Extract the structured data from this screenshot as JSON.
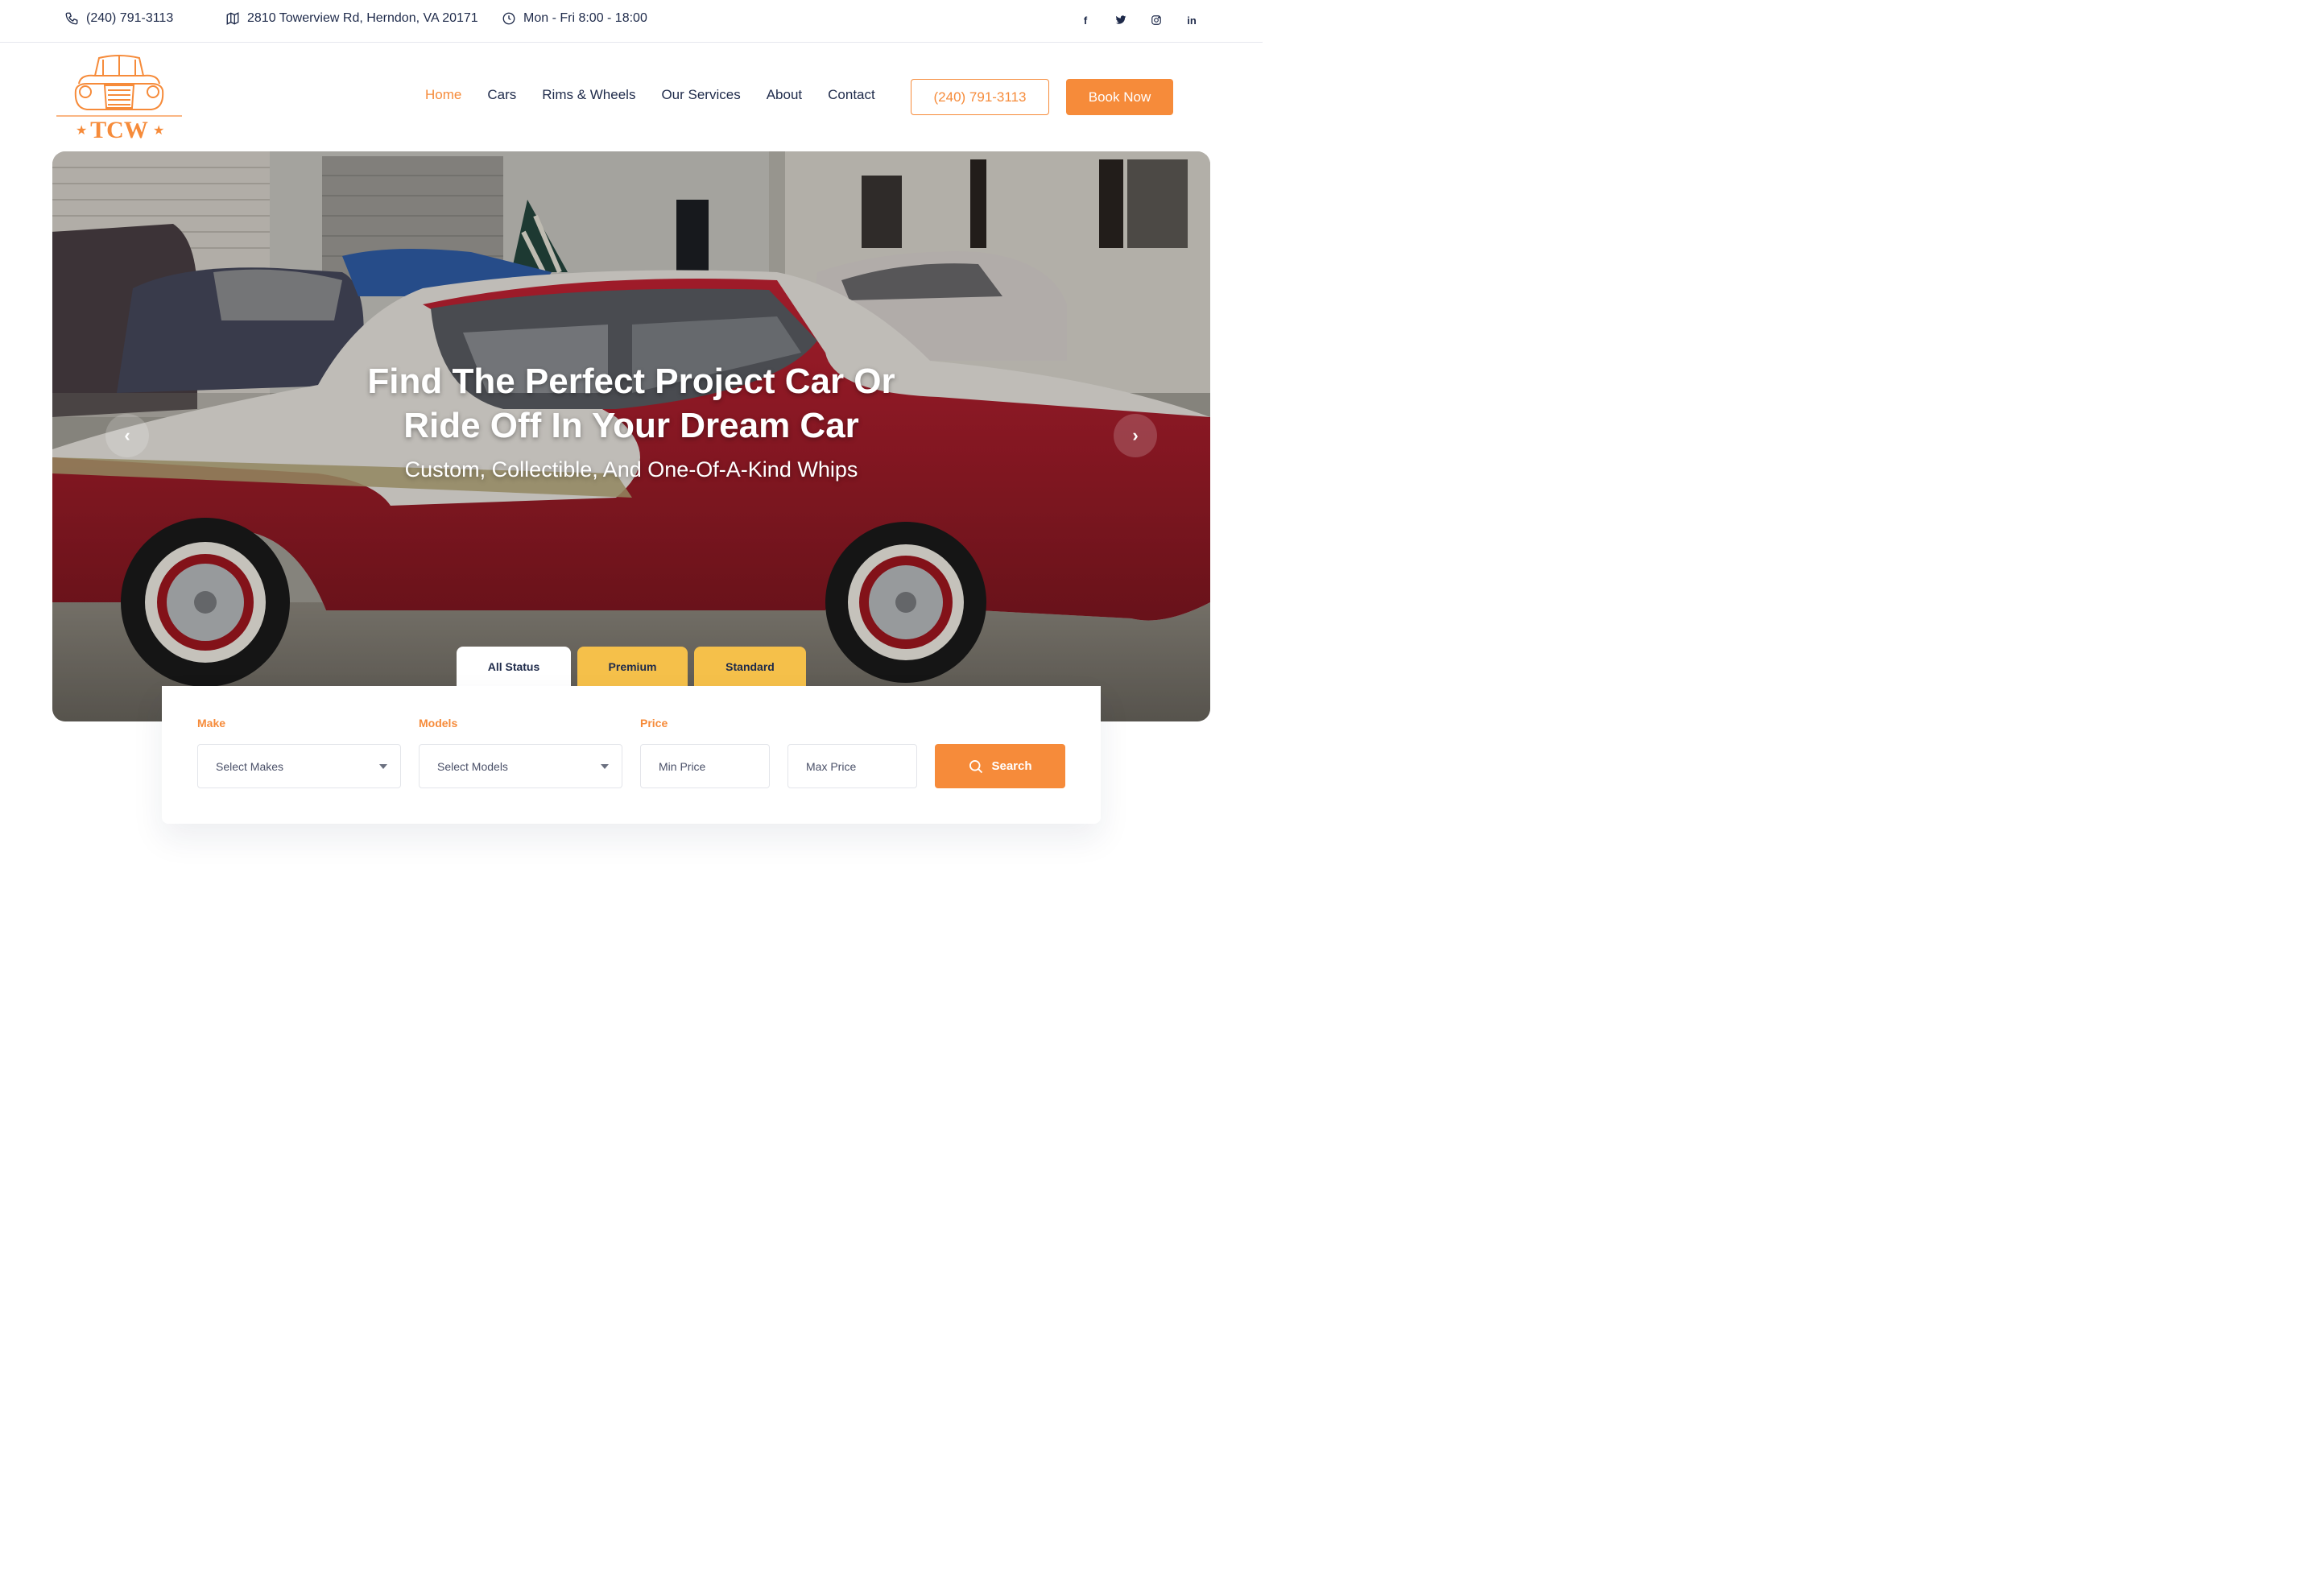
{
  "topbar": {
    "phone": "(240) 791-3113",
    "address": "2810 Towerview Rd, Herndon, VA 20171",
    "hours": "Mon - Fri 8:00 - 18:00",
    "socials": [
      {
        "icon": "facebook-icon",
        "glyph": "f"
      },
      {
        "icon": "twitter-icon",
        "glyph": "t"
      },
      {
        "icon": "instagram-icon",
        "glyph": "◎"
      },
      {
        "icon": "linkedin-icon",
        "glyph": "in"
      }
    ]
  },
  "header": {
    "logo_text": "TCW",
    "nav": [
      {
        "label": "Home",
        "active": true
      },
      {
        "label": "Cars"
      },
      {
        "label": "Rims & Wheels"
      },
      {
        "label": "Our Services"
      },
      {
        "label": "About"
      },
      {
        "label": "Contact"
      }
    ],
    "phone_button": "(240) 791-3113",
    "book_button": "Book Now"
  },
  "hero": {
    "title_line1": "Find The Perfect Project Car Or",
    "title_line2": "Ride Off In Your Dream Car",
    "subtitle": "Custom, Collectible, And One-Of-A-Kind Whips",
    "prev_glyph": "‹",
    "next_glyph": "›"
  },
  "tabs": [
    "All Status",
    "Premium",
    "Standard"
  ],
  "search": {
    "make_label": "Make",
    "make_placeholder": "Select Makes",
    "models_label": "Models",
    "models_placeholder": "Select Models",
    "price_label": "Price",
    "min_price_placeholder": "Min Price",
    "max_price_placeholder": "Max Price",
    "search_button": "Search"
  },
  "colors": {
    "accent": "#f68b3a",
    "tab_yellow": "#f5c04a",
    "text_dark": "#1e2a4a"
  }
}
